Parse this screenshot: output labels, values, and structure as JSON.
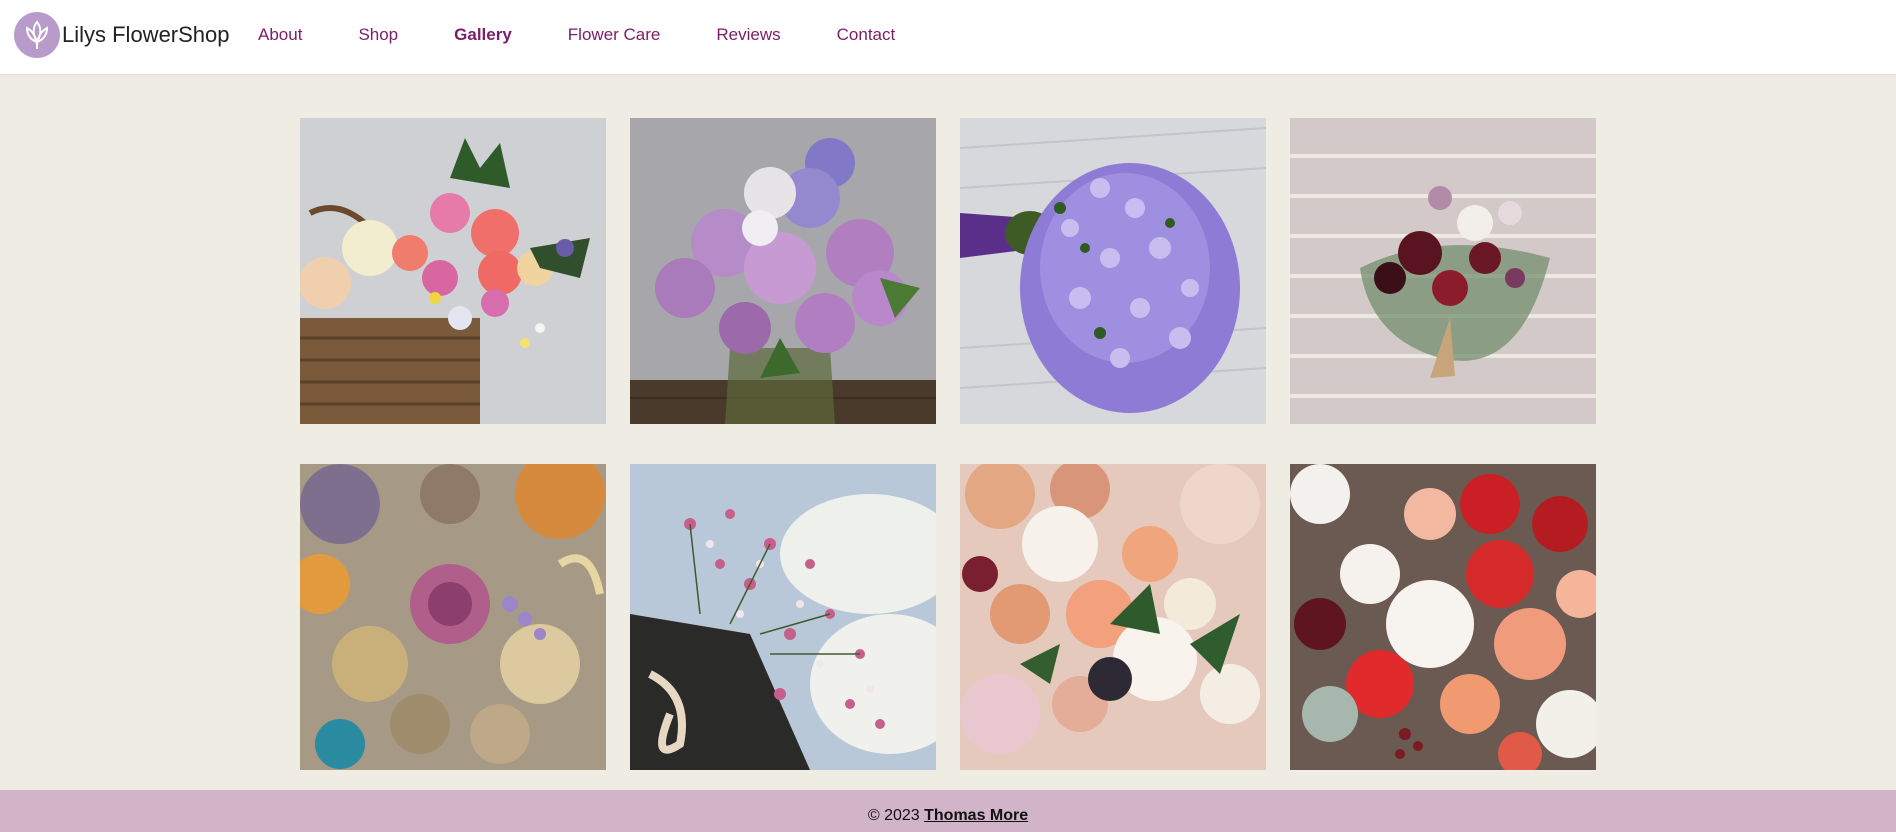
{
  "brand": {
    "name": "Lilys FlowerShop",
    "logo_icon": "tulip-icon"
  },
  "nav": {
    "items": [
      {
        "label": "About"
      },
      {
        "label": "Shop"
      },
      {
        "label": "Gallery",
        "active": true
      },
      {
        "label": "Flower Care"
      },
      {
        "label": "Reviews"
      },
      {
        "label": "Contact"
      }
    ]
  },
  "gallery": {
    "images": [
      {
        "subject": "basket-roses-photo"
      },
      {
        "subject": "lilac-vase-photo"
      },
      {
        "subject": "purple-bouquet-photo"
      },
      {
        "subject": "burgundy-bouquet-photo"
      },
      {
        "subject": "dried-flowers-photo"
      },
      {
        "subject": "gypsophila-basket-photo"
      },
      {
        "subject": "ranunculus-bouquet-photo"
      },
      {
        "subject": "red-white-roses-photo"
      }
    ]
  },
  "footer": {
    "copyright": "© 2023",
    "author": "Thomas More"
  },
  "colors": {
    "nav_link": "#7b1d68",
    "page_background": "#efece4",
    "footer_background": "#d2b4c9",
    "logo_background": "#b89acb"
  }
}
